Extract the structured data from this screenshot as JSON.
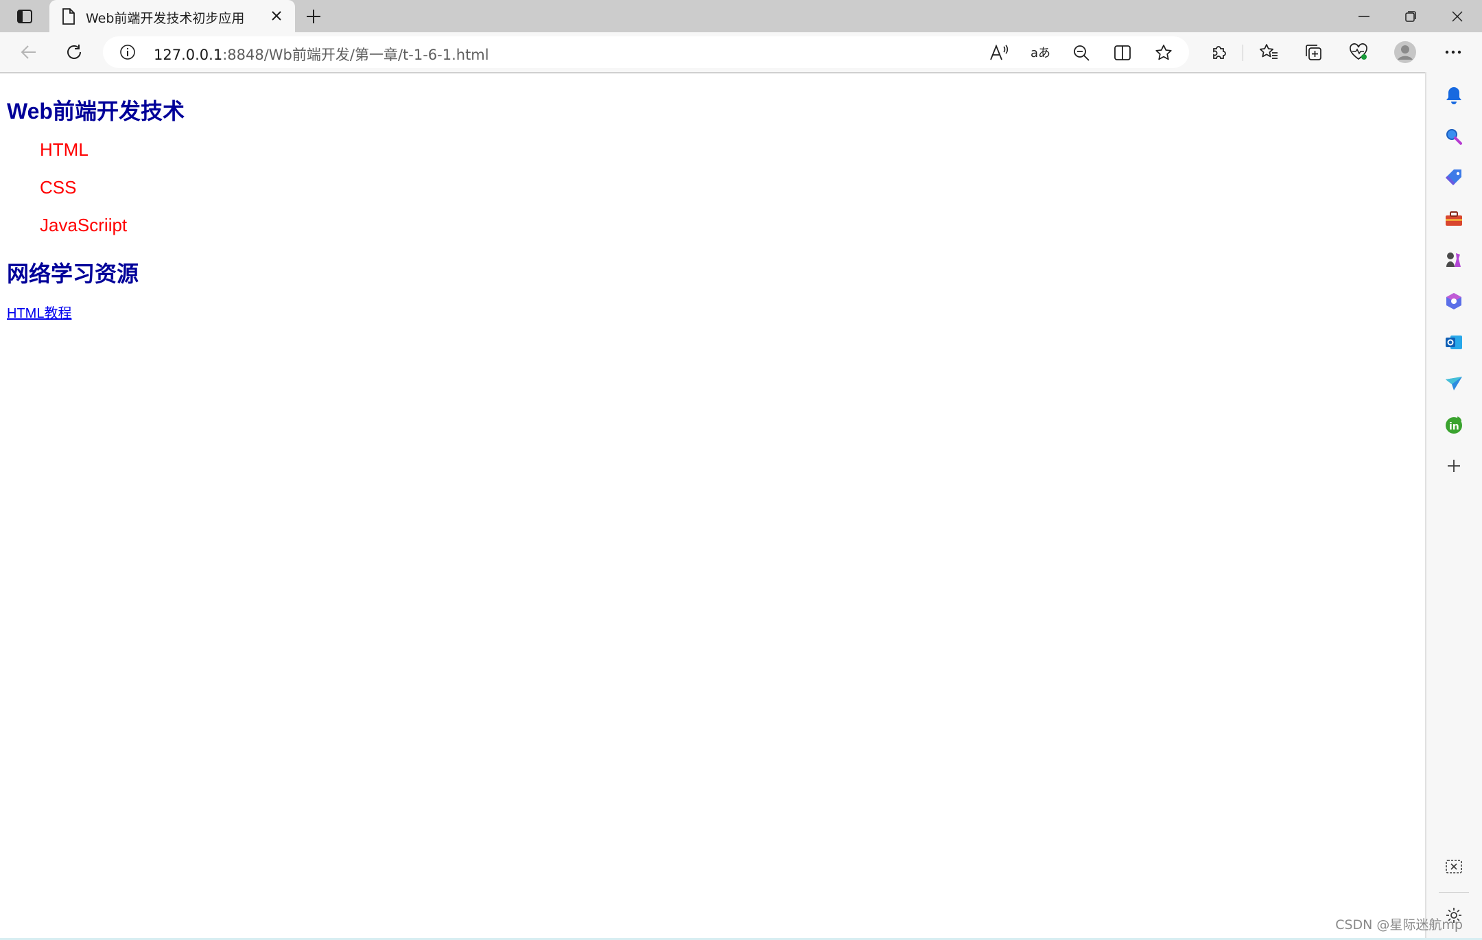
{
  "tab": {
    "title": "Web前端开发技术初步应用"
  },
  "address_bar": {
    "host": "127.0.0.1",
    "path": ":8848/Wb前端开发/第一章/t-1-6-1.html"
  },
  "page": {
    "heading1": "Web前端开发技术",
    "list_items": [
      "HTML",
      "CSS",
      "JavaScriipt"
    ],
    "heading2": "网络学习资源",
    "link_text": "HTML教程"
  },
  "watermark": "CSDN @星际迷航mp",
  "colors": {
    "heading": "#000099",
    "list_item": "#ff0000",
    "link": "#0000ee"
  },
  "icons": {
    "tab_actions": "tab-actions-icon",
    "page": "page-icon",
    "close": "close-icon",
    "new_tab": "plus-icon",
    "minimize": "minimize-icon",
    "restore": "restore-icon",
    "window_close": "close-icon",
    "back": "back-arrow-icon",
    "refresh": "refresh-icon",
    "info": "info-icon",
    "read_aloud": "read-aloud-icon",
    "translate": "translate-icon",
    "zoom_out": "zoom-out-icon",
    "split_screen": "split-screen-icon",
    "favorite": "star-icon",
    "extensions": "extensions-icon",
    "favorites": "favorites-icon",
    "collections": "collections-icon",
    "performance": "heart-pulse-icon",
    "profile": "profile-icon",
    "more": "more-icon",
    "sidebar": [
      "bell-icon",
      "search-icon",
      "shopping-tag-icon",
      "tools-icon",
      "games-icon",
      "microsoft365-icon",
      "outlook-icon",
      "drop-icon",
      "linkedin-icon",
      "add-icon",
      "screenshot-icon",
      "settings-icon"
    ]
  }
}
